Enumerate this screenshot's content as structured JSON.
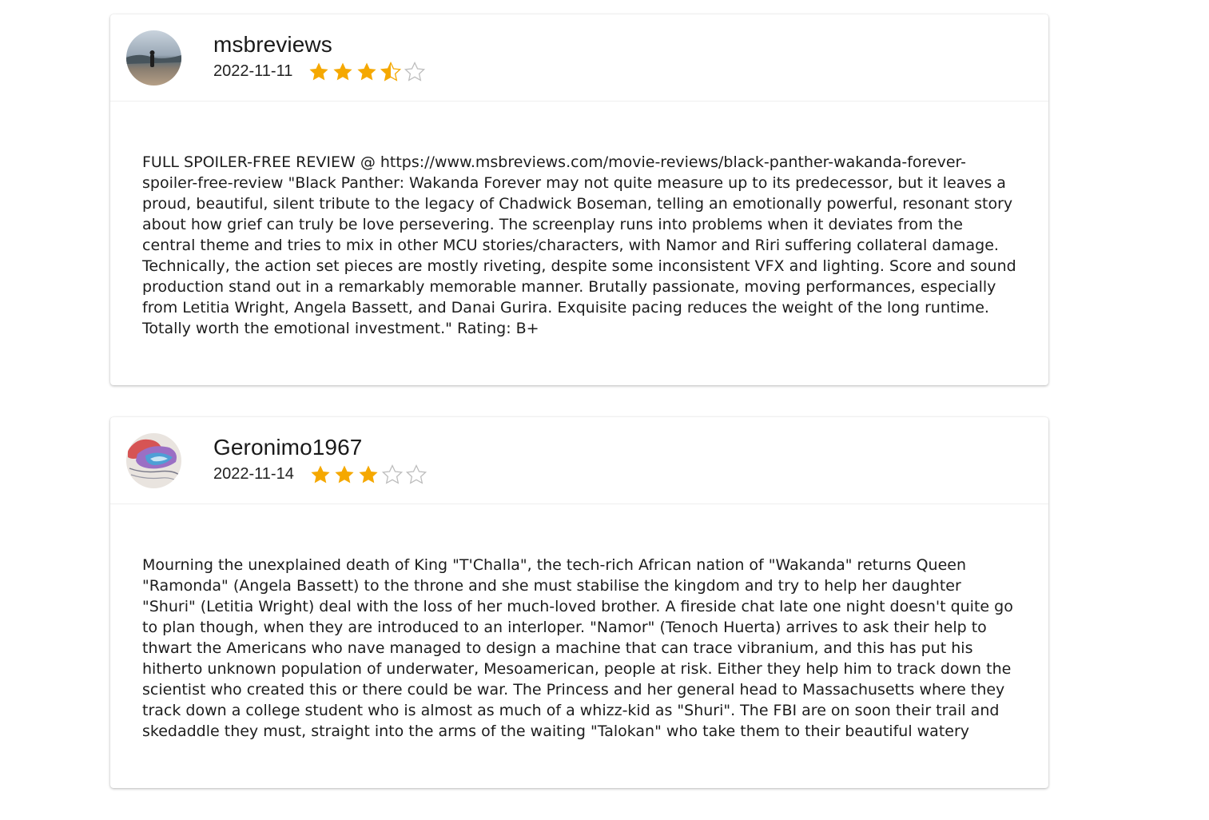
{
  "colors": {
    "star_filled": "#F5A800",
    "star_empty": "#BDBDBD",
    "card_bg": "#FFFFFF"
  },
  "reviews": [
    {
      "author": "msbreviews",
      "date": "2022-11-11",
      "rating_stars": 3.5,
      "rating_max": 5,
      "avatar_icon": "avatar-photo-person-landscape",
      "body": "FULL SPOILER-FREE REVIEW @ https://www.msbreviews.com/movie-reviews/black-panther-wakanda-forever-spoiler-free-review \"Black Panther: Wakanda Forever may not quite measure up to its predecessor, but it leaves a proud, beautiful, silent tribute to the legacy of Chadwick Boseman, telling an emotionally powerful, resonant story about how grief can truly be love persevering. The screenplay runs into problems when it deviates from the central theme and tries to mix in other MCU stories/characters, with Namor and Riri suffering collateral damage. Technically, the action set pieces are mostly riveting, despite some inconsistent VFX and lighting. Score and sound production stand out in a remarkably memorable manner. Brutally passionate, moving performances, especially from Letitia Wright, Angela Bassett, and Danai Gurira. Exquisite pacing reduces the weight of the long runtime. Totally worth the emotional investment.\" Rating: B+"
    },
    {
      "author": "Geronimo1967",
      "date": "2022-11-14",
      "rating_stars": 3,
      "rating_max": 5,
      "avatar_icon": "avatar-painting",
      "body": "Mourning the unexplained death of King \"T'Challa\", the tech-rich African nation of \"Wakanda\" returns Queen \"Ramonda\" (Angela Bassett) to the throne and she must stabilise the kingdom and try to help her daughter \"Shuri\" (Letitia Wright) deal with the loss of her much-loved brother. A fireside chat late one night doesn't quite go to plan though, when they are introduced to an interloper. \"Namor\" (Tenoch Huerta) arrives to ask their help to thwart the Americans who nave managed to design a machine that can trace vibranium, and this has put his hitherto unknown population of underwater, Mesoamerican, people at risk. Either they help him to track down the scientist who created this or there could be war. The Princess and her general head to Massachusetts where they track down a college student who is almost as much of a whizz-kid as \"Shuri\". The FBI are on soon their trail and skedaddle they must, straight into the arms of the waiting \"Talokan\" who take them to their beautiful watery"
    }
  ]
}
